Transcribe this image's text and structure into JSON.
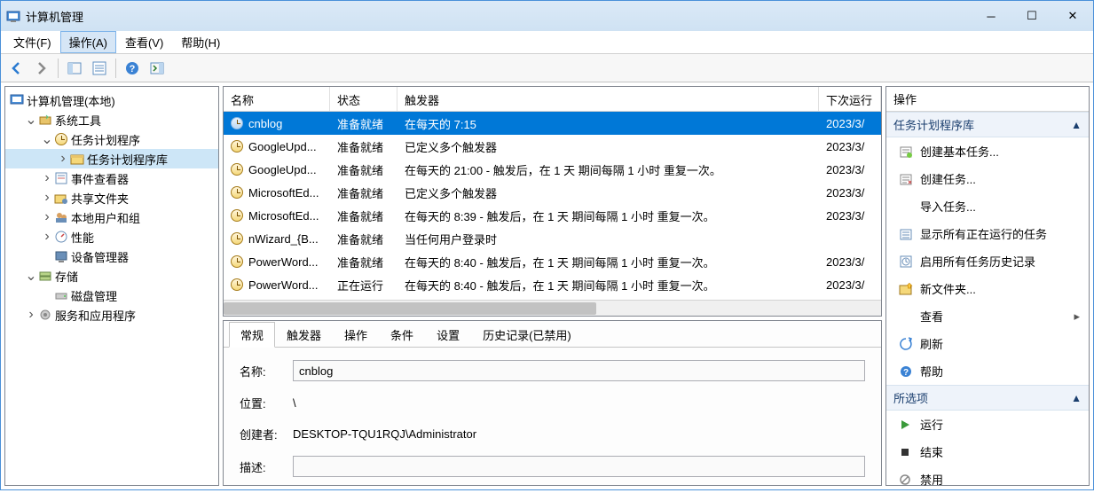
{
  "window": {
    "title": "计算机管理"
  },
  "menubar": [
    {
      "label": "文件(F)"
    },
    {
      "label": "操作(A)"
    },
    {
      "label": "查看(V)"
    },
    {
      "label": "帮助(H)"
    }
  ],
  "tree": {
    "root": "计算机管理(本地)",
    "nodes": [
      {
        "label": "系统工具",
        "depth": 1,
        "expand": "▾"
      },
      {
        "label": "任务计划程序",
        "depth": 2,
        "expand": "▾"
      },
      {
        "label": "任务计划程序库",
        "depth": 3,
        "expand": "▸",
        "selected": true
      },
      {
        "label": "事件查看器",
        "depth": 2,
        "expand": "▸"
      },
      {
        "label": "共享文件夹",
        "depth": 2,
        "expand": "▸"
      },
      {
        "label": "本地用户和组",
        "depth": 2,
        "expand": "▸"
      },
      {
        "label": "性能",
        "depth": 2,
        "expand": "▸"
      },
      {
        "label": "设备管理器",
        "depth": 2,
        "expand": " "
      },
      {
        "label": "存储",
        "depth": 1,
        "expand": "▾"
      },
      {
        "label": "磁盘管理",
        "depth": 2,
        "expand": " "
      },
      {
        "label": "服务和应用程序",
        "depth": 1,
        "expand": "▸"
      }
    ]
  },
  "list": {
    "headers": {
      "name": "名称",
      "state": "状态",
      "trigger": "触发器",
      "next": "下次运行"
    },
    "rows": [
      {
        "name": "cnblog",
        "state": "准备就绪",
        "trigger": "在每天的 7:15",
        "next": "2023/3/",
        "selected": true
      },
      {
        "name": "GoogleUpd...",
        "state": "准备就绪",
        "trigger": "已定义多个触发器",
        "next": "2023/3/"
      },
      {
        "name": "GoogleUpd...",
        "state": "准备就绪",
        "trigger": "在每天的 21:00 - 触发后，在 1 天 期间每隔 1 小时 重复一次。",
        "next": "2023/3/"
      },
      {
        "name": "MicrosoftEd...",
        "state": "准备就绪",
        "trigger": "已定义多个触发器",
        "next": "2023/3/"
      },
      {
        "name": "MicrosoftEd...",
        "state": "准备就绪",
        "trigger": "在每天的 8:39 - 触发后，在 1 天 期间每隔 1 小时 重复一次。",
        "next": "2023/3/"
      },
      {
        "name": "nWizard_{B...",
        "state": "准备就绪",
        "trigger": "当任何用户登录时",
        "next": ""
      },
      {
        "name": "PowerWord...",
        "state": "准备就绪",
        "trigger": "在每天的 8:40 - 触发后，在 1 天 期间每隔 1 小时 重复一次。",
        "next": "2023/3/"
      },
      {
        "name": "PowerWord...",
        "state": "正在运行",
        "trigger": "在每天的 8:40 - 触发后，在 1 天 期间每隔 1 小时 重复一次。",
        "next": "2023/3/"
      }
    ]
  },
  "details": {
    "tabs": [
      "常规",
      "触发器",
      "操作",
      "条件",
      "设置",
      "历史记录(已禁用)"
    ],
    "active_tab": 0,
    "name_label": "名称:",
    "location_label": "位置:",
    "creator_label": "创建者:",
    "description_label": "描述:",
    "name_value": "cnblog",
    "location_value": "\\",
    "creator_value": "DESKTOP-TQU1RQJ\\Administrator",
    "description_value": ""
  },
  "actions": {
    "title": "操作",
    "section1": "任务计划程序库",
    "items1": [
      "创建基本任务...",
      "创建任务...",
      "导入任务...",
      "显示所有正在运行的任务",
      "启用所有任务历史记录",
      "新文件夹...",
      "查看",
      "刷新",
      "帮助"
    ],
    "section2": "所选项",
    "items2": [
      "运行",
      "结束",
      "禁用"
    ]
  }
}
